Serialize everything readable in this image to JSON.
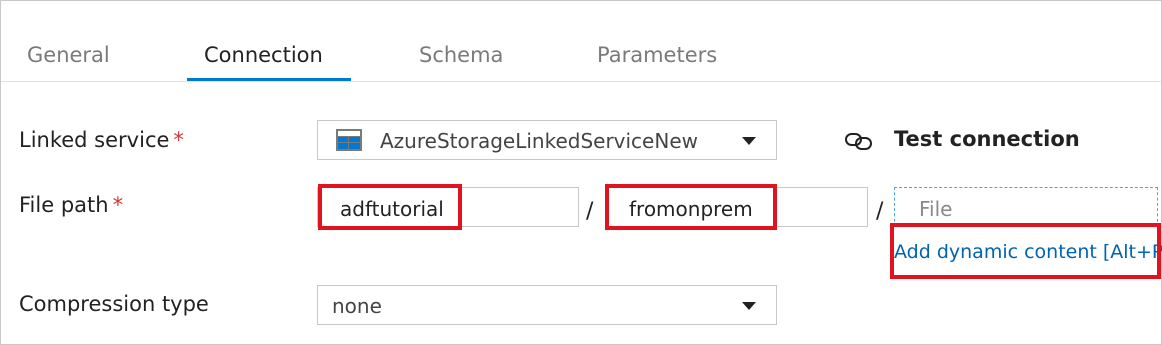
{
  "tabs": [
    "General",
    "Connection",
    "Schema",
    "Parameters"
  ],
  "linked_service": {
    "label": "Linked service",
    "required_mark": "*",
    "value": "AzureStorageLinkedServiceNew"
  },
  "test_connection": {
    "label": "Test connection"
  },
  "file_path": {
    "label": "File path",
    "required_mark": "*",
    "container": "adftutorial",
    "separator1": "/",
    "directory": "fromonprem",
    "separator2": "/",
    "file_placeholder": "File",
    "dynamic_link": "Add dynamic content [Alt+P]"
  },
  "compression": {
    "label": "Compression type",
    "value": "none"
  },
  "colors": {
    "accent": "#0078d4",
    "highlight": "#e0141e",
    "required": "#d13438",
    "link": "#0063b1"
  },
  "icons": {
    "linked_service": "storage-service-icon",
    "test_connection": "link-icon",
    "dropdown": "caret-down-icon"
  }
}
